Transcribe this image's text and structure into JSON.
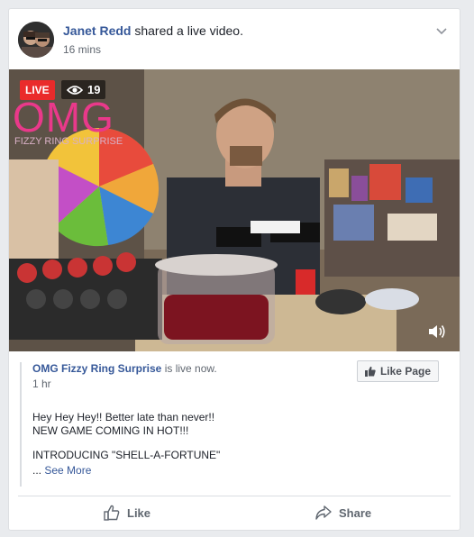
{
  "post": {
    "author": "Janet Redd",
    "action": "shared a live video.",
    "time": "16 mins"
  },
  "video": {
    "live_label": "LIVE",
    "viewers": "19",
    "brand_overlay": "OMG",
    "brand_overlay_sub": "FIZZY RING SURPRISE"
  },
  "shared": {
    "page_name": "OMG Fizzy Ring Surprise",
    "status": "is live now.",
    "time": "1 hr",
    "like_page_label": "Like Page",
    "lines": [
      "Hey Hey Hey!! Better late than never!!",
      "NEW GAME COMING IN HOT!!!",
      "INTRODUCING \"SHELL-A-FORTUNE\""
    ],
    "ellipsis": "...",
    "see_more": "See More"
  },
  "actions": {
    "like": "Like",
    "share": "Share"
  },
  "colors": {
    "link": "#365899",
    "live": "#ea2b2b",
    "brand_pink": "#e9398a"
  }
}
